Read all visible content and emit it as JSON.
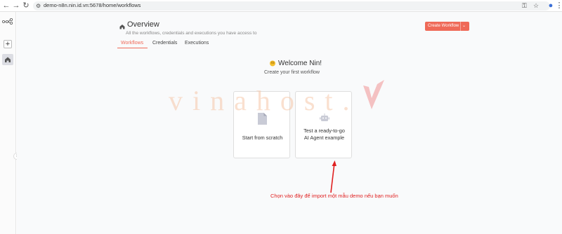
{
  "browser": {
    "url": "demo-n8n.nin.id.vn:5678/home/workflows",
    "icons": [
      "back-icon",
      "forward-icon",
      "reload-icon",
      "tune-icon",
      "key-icon",
      "star-icon",
      "profile-icon",
      "menu-icon"
    ]
  },
  "sidebar": {
    "items": [
      {
        "name": "logo",
        "icon": "workflow-logo-icon"
      },
      {
        "name": "add",
        "icon": "plus-icon",
        "label": "+"
      },
      {
        "name": "home",
        "icon": "home-icon"
      }
    ],
    "collapse_icon": "chevron-right-icon",
    "collapse_label": "›"
  },
  "header": {
    "title": "Overview",
    "subtitle": "All the workflows, credentials and executions you have access to",
    "cta_label": "Create Workflow",
    "cta_caret": "⌄"
  },
  "tabs": [
    {
      "label": "Workflows",
      "active": true
    },
    {
      "label": "Credentials",
      "active": false
    },
    {
      "label": "Executions",
      "active": false
    }
  ],
  "empty_state": {
    "welcome": "Welcome Nin!",
    "subtitle": "Create your first workflow",
    "cards": [
      {
        "label": "Start from scratch",
        "icon": "file-icon"
      },
      {
        "label_line1": "Test a ready-to-go",
        "label_line2": "AI Agent example",
        "icon": "robot-icon"
      }
    ]
  },
  "watermark": {
    "text": "vinahost."
  },
  "annotation": {
    "text": "Chọn vào đây để import một mẫu demo nếu bạn muốn"
  },
  "colors": {
    "accent": "#ef6a58",
    "annotation": "#e02020",
    "background": "#f9fafb"
  }
}
